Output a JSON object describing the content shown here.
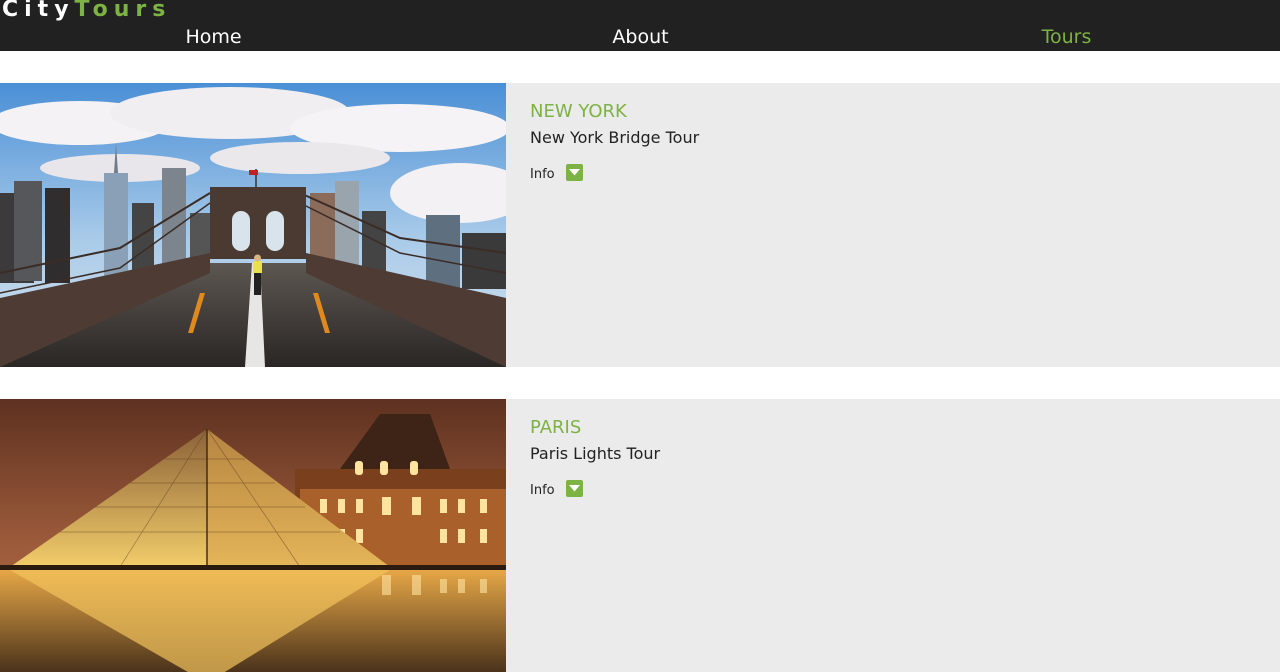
{
  "brand": {
    "part1": "City",
    "part2": "Tours"
  },
  "nav": [
    {
      "label": "Home"
    },
    {
      "label": "About"
    },
    {
      "label": "Tours"
    }
  ],
  "tours": [
    {
      "city": "NEW YORK",
      "name": "New York Bridge Tour",
      "info_label": "Info",
      "image": "brooklyn-bridge-photo"
    },
    {
      "city": "PARIS",
      "name": "Paris Lights Tour",
      "info_label": "Info",
      "image": "louvre-pyramid-photo"
    }
  ],
  "colors": {
    "accent": "#7cb342",
    "nav_bg": "#212121",
    "card_bg": "#ebebeb"
  },
  "icons": {
    "info_toggle": "caret-down-icon"
  }
}
